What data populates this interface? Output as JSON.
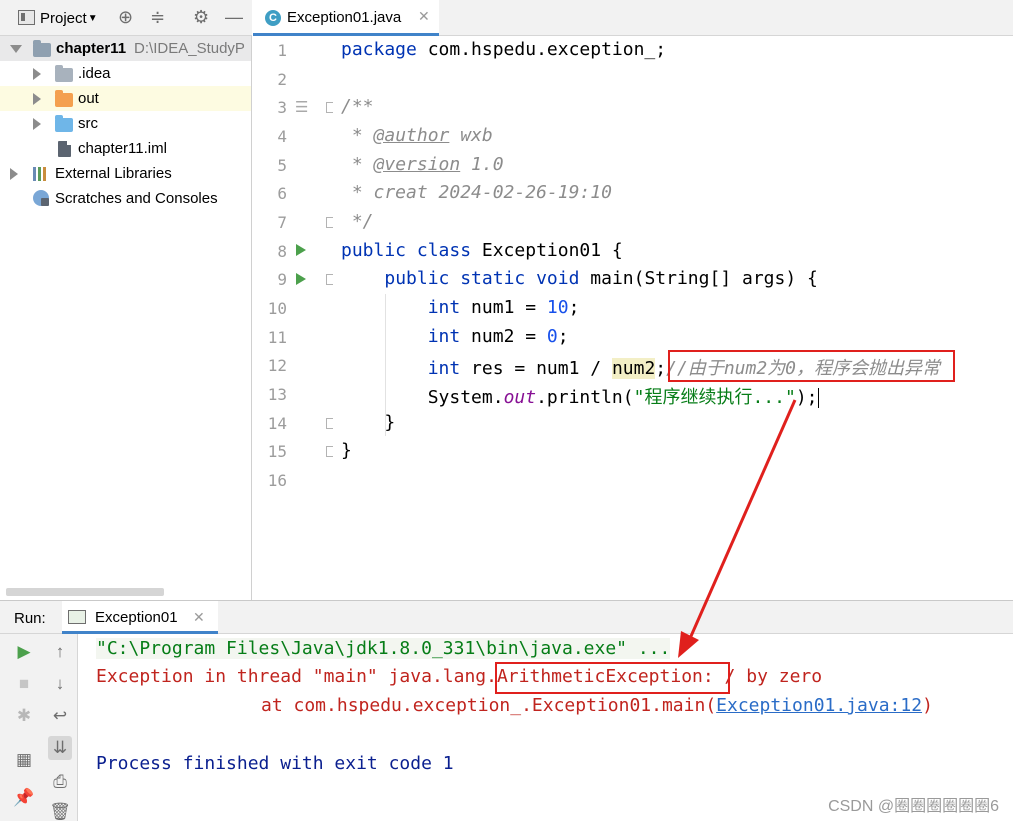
{
  "project_panel": {
    "title": "Project",
    "tree": [
      {
        "label": "chapter11",
        "path": "D:\\IDEA_StudyP",
        "icon": "module-folder-icon",
        "expanded": true
      },
      {
        "label": ".idea",
        "icon": "folder-icon"
      },
      {
        "label": "out",
        "icon": "folder-icon"
      },
      {
        "label": "src",
        "icon": "source-folder-icon"
      },
      {
        "label": "chapter11.iml",
        "icon": "iml-file-icon"
      },
      {
        "label": "External Libraries",
        "icon": "libraries-icon"
      },
      {
        "label": "Scratches and Consoles",
        "icon": "scratches-icon"
      }
    ]
  },
  "editor": {
    "tab": {
      "label": "Exception01.java",
      "icon": "java-class-icon"
    },
    "line_numbers": [
      "1",
      "2",
      "3",
      "4",
      "5",
      "6",
      "7",
      "8",
      "9",
      "10",
      "11",
      "12",
      "13",
      "14",
      "15",
      "16"
    ],
    "code": {
      "l1_kw": "package",
      "l1_rest": " com.hspedu.exception_;",
      "l3": "/**",
      "l4_star": " * ",
      "l4_tag": "@author",
      "l4_rest": " wxb",
      "l5_star": " * ",
      "l5_tag": "@version",
      "l5_rest": " 1.0",
      "l6": " * creat 2024-02-26-19:10",
      "l7": " */",
      "l8_kw": "public class",
      "l8_rest": " Exception01 {",
      "l9_kw": "public static void",
      "l9_rest": " main(String[] args) {",
      "l10_kw": "int",
      "l10_a": " num1 = ",
      "l10_num": "10",
      "l10_b": ";",
      "l11_kw": "int",
      "l11_a": " num2 = ",
      "l11_num": "0",
      "l11_b": ";",
      "l12_kw": "int",
      "l12_a": " res = num1 / ",
      "l12_var": "num2",
      "l12_b": ";",
      "l12_comment": "//由于num2为0，程序会抛出异常",
      "l13_a": "System.",
      "l13_field": "out",
      "l13_b": ".println(",
      "l13_str": "\"程序继续执行...\"",
      "l13_c": ");",
      "l14": "}",
      "l15": "}"
    }
  },
  "run_panel": {
    "title": "Run:",
    "tab_label": "Exception01",
    "console": {
      "cmd": "\"C:\\Program Files\\Java\\jdk1.8.0_331\\bin\\java.exe\" ...",
      "err_prefix": "Exception in thread \"main\" java.lang.",
      "err_exception": "ArithmeticException:",
      "err_suffix": " / by zero",
      "trace_prefix": "at com.hspedu.exception_.Exception01.main(",
      "trace_link": "Exception01.java:12",
      "trace_suffix": ")",
      "exit": "Process finished with exit code 1"
    }
  },
  "watermark": "CSDN @圈圈圈圈圈圈6",
  "colors": {
    "annotation_red": "#e0201d",
    "keyword": "#0033b3",
    "string": "#067d17",
    "error_text": "#c0241e"
  }
}
